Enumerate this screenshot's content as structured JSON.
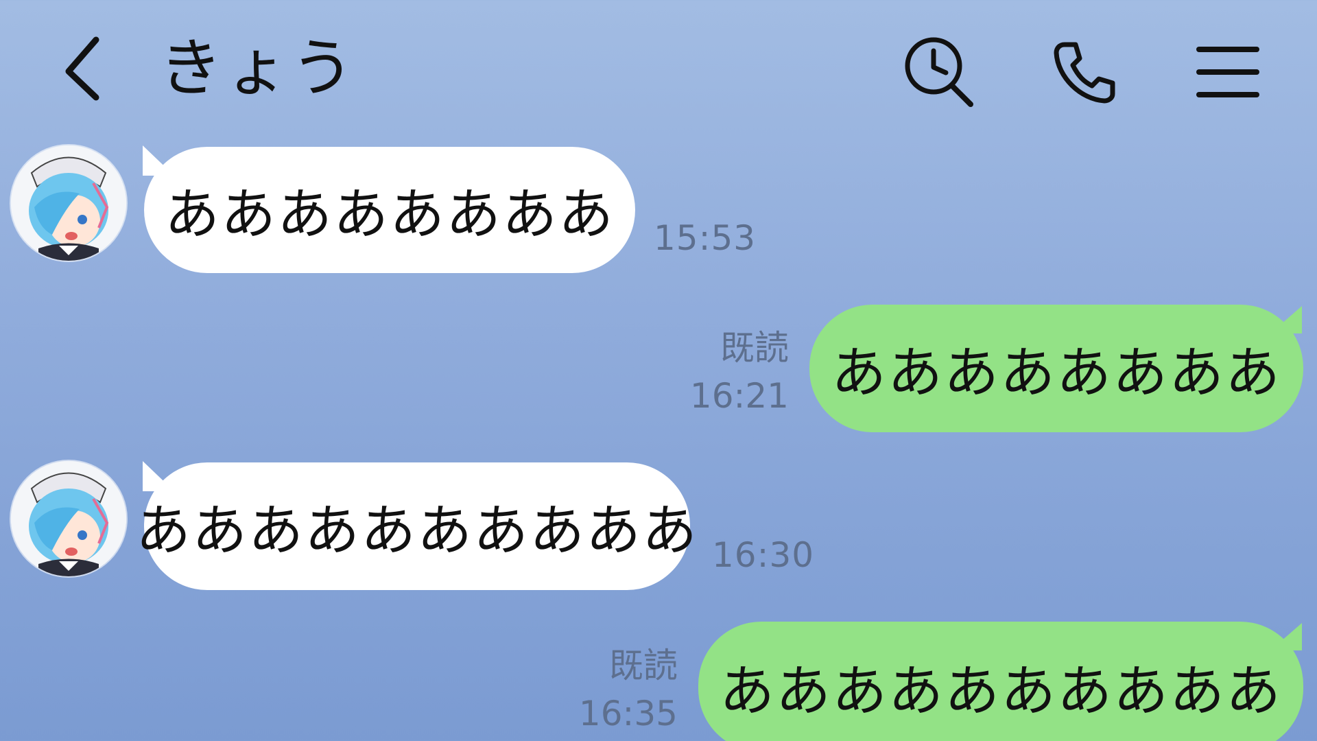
{
  "header": {
    "title": "きょう",
    "back_icon": "chevron-left-icon",
    "search_icon": "history-search-icon",
    "call_icon": "phone-icon",
    "menu_icon": "hamburger-menu-icon"
  },
  "colors": {
    "background_top": "#a2bce3",
    "background_bottom": "#7b9bd2",
    "incoming_bubble": "#ffffff",
    "outgoing_bubble": "#93e286",
    "meta_text": "#5d6f8e"
  },
  "messages": [
    {
      "direction": "incoming",
      "text": "ああああああああ",
      "time": "15:53",
      "avatar": "anime-girl-avatar"
    },
    {
      "direction": "outgoing",
      "text": "ああああああああ",
      "read_label": "既読",
      "time": "16:21"
    },
    {
      "direction": "incoming",
      "text": "ああああああああああ",
      "time": "16:30",
      "avatar": "anime-girl-avatar"
    },
    {
      "direction": "outgoing",
      "text": "ああああああああああ",
      "read_label": "既読",
      "time": "16:35"
    }
  ]
}
